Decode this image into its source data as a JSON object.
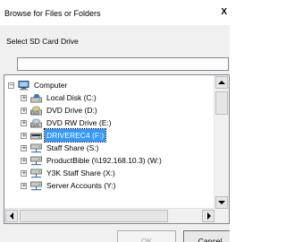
{
  "window": {
    "title": "Browse for Files or Folders",
    "close_label": "X"
  },
  "dialog": {
    "instruction": "Select SD Card Drive",
    "path_value": ""
  },
  "tree": {
    "root": {
      "label": "Computer",
      "icon": "computer-icon",
      "expander": "−"
    },
    "items": [
      {
        "label": "Local Disk (C:)",
        "icon": "local-disk-icon",
        "expander": "+"
      },
      {
        "label": "DVD Drive (D:)",
        "icon": "dvd-drive-icon",
        "expander": "+"
      },
      {
        "label": "DVD RW Drive (E:)",
        "icon": "dvd-rw-drive-icon",
        "expander": "+"
      },
      {
        "label": "DRIVEREC4 (F:)",
        "icon": "removable-drive-icon",
        "expander": "+",
        "selected": true
      },
      {
        "label": "Staff Share (S:)",
        "icon": "network-drive-icon",
        "expander": "+"
      },
      {
        "label": "ProductBible (\\\\192.168.10.3) (W:)",
        "icon": "network-drive-icon",
        "expander": "+"
      },
      {
        "label": "Y3K Staff Share (X:)",
        "icon": "network-drive-icon",
        "expander": "+"
      },
      {
        "label": "Server Accounts (Y:)",
        "icon": "network-drive-icon",
        "expander": "+"
      }
    ]
  },
  "buttons": {
    "ok_label": "OK",
    "cancel_label": "Cancel"
  },
  "colors": {
    "selection": "#3399ff",
    "window_bg": "#f0f0f0"
  }
}
